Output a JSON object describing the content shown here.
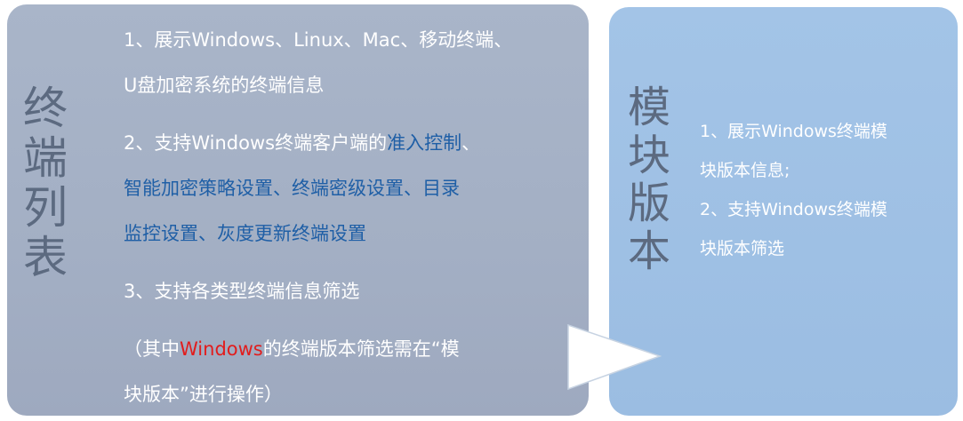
{
  "left_panel": {
    "title": "终端列表",
    "item1_line1": "1、展示Windows、Linux、Mac、移动终端、",
    "item1_line2": "U盘加密系统的终端信息",
    "item2_prefix": "2、支持Windows终端客户端的",
    "item2_hl1": "准入控制",
    "item2_sep": "、",
    "item2_line2": "智能加密策略设置、终端密级设置、目录",
    "item2_line3": "监控设置、灰度更新终端设置",
    "item3": "3、支持各类型终端信息筛选",
    "note_prefix": "（其中",
    "note_hl": "Windows",
    "note_suffix": "的终端版本筛选需在“模",
    "note_line2": "块版本”进行操作）"
  },
  "right_panel": {
    "title": "模块版本",
    "item1_line1": "1、展示Windows终端模",
    "item1_line2": "块版本信息;",
    "item2_line1": "2、支持Windows终端模",
    "item2_line2": "块版本筛选"
  },
  "colors": {
    "left_panel_bg": "#a6b2c6",
    "right_panel_bg": "#9fc1e5",
    "title_color": "#5c6a80",
    "highlight_blue": "#1f5fa6",
    "highlight_red": "#e21c1c"
  }
}
